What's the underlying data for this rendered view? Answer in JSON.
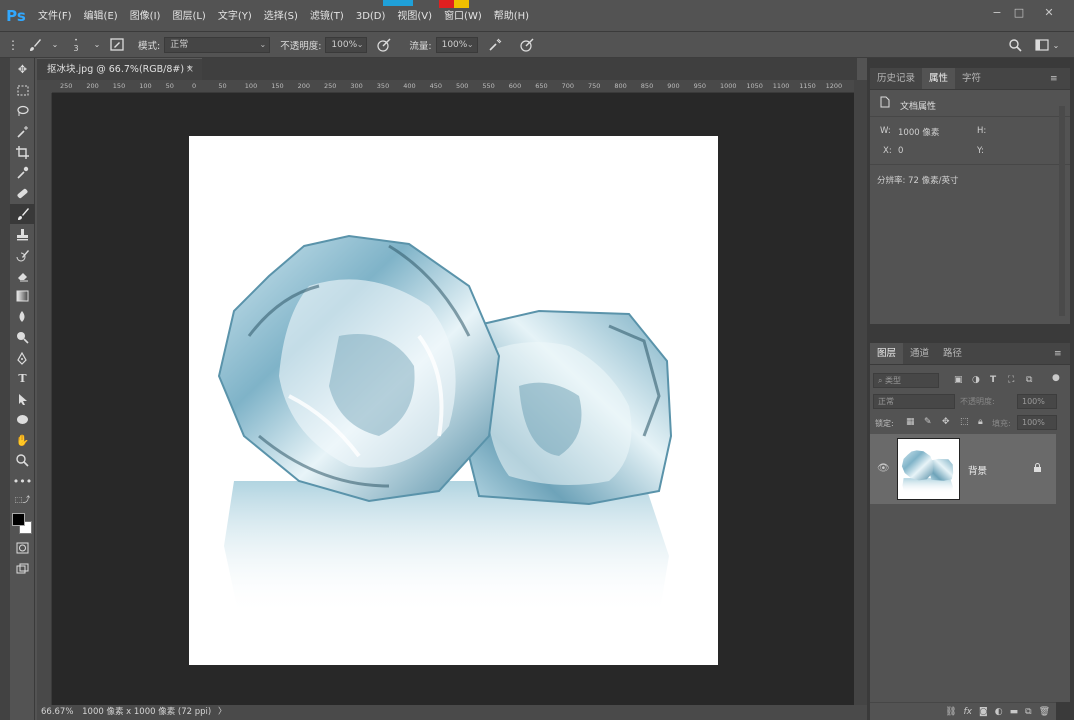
{
  "app": {
    "logo": "Ps"
  },
  "menu": [
    "文件(F)",
    "编辑(E)",
    "图像(I)",
    "图层(L)",
    "文字(Y)",
    "选择(S)",
    "滤镜(T)",
    "3D(D)",
    "视图(V)",
    "窗口(W)",
    "帮助(H)"
  ],
  "window_controls": {
    "minimize": "−",
    "maximize": "□",
    "close": "✕"
  },
  "options": {
    "brush_size": "3",
    "mode_label": "模式:",
    "mode_value": "正常",
    "opacity_label": "不透明度:",
    "opacity_value": "100%",
    "flow_label": "流量:",
    "flow_value": "100%"
  },
  "document": {
    "tab_title": "抠冰块.jpg @ 66.7%(RGB/8#) *",
    "tab_close": "×",
    "ruler_ticks": [
      "250",
      "200",
      "150",
      "100",
      "50",
      "0",
      "50",
      "100",
      "150",
      "200",
      "250",
      "300",
      "350",
      "400",
      "450",
      "500",
      "550",
      "600",
      "650",
      "700",
      "750",
      "800",
      "850",
      "900",
      "950",
      "1000",
      "1050",
      "1100",
      "1150",
      "1200"
    ]
  },
  "status": {
    "zoom": "66.67%",
    "info": "1000 像素 x 1000 像素 (72 ppi)",
    "arrow": "〉"
  },
  "properties_panel": {
    "tabs": [
      "历史记录",
      "属性",
      "字符"
    ],
    "active_tab": "属性",
    "header": "文档属性",
    "w_label": "W:",
    "w_value": "1000 像素",
    "h_label": "H:",
    "x_label": "X:",
    "x_value": "0",
    "y_label": "Y:",
    "resolution": "分辨率: 72 像素/英寸"
  },
  "layers_panel": {
    "tabs": [
      "图层",
      "通道",
      "路径"
    ],
    "active_tab": "图层",
    "search_placeholder": "类型",
    "blend_mode": "正常",
    "opacity_label": "不透明度:",
    "opacity_value": "100%",
    "lock_label": "锁定:",
    "fill_label": "填充:",
    "fill_value": "100%",
    "layer_name": "背景"
  }
}
